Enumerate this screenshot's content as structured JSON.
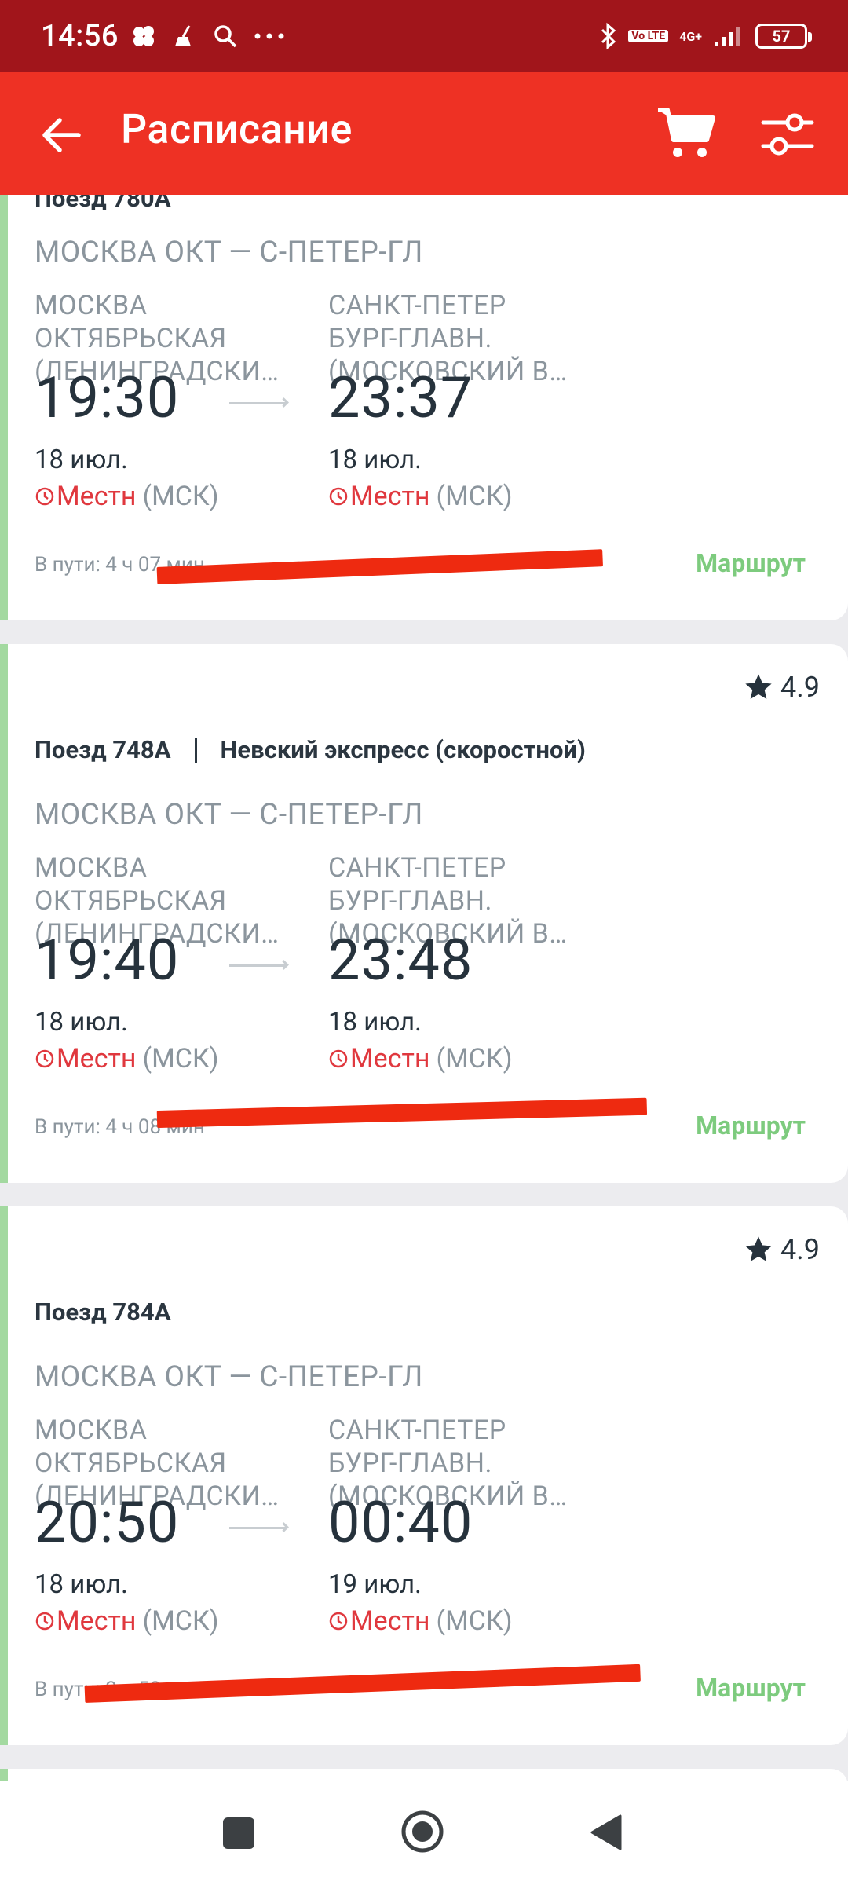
{
  "status_bar": {
    "time": "14:56",
    "network": "4G+",
    "volte": "Vo LTE",
    "battery": "57"
  },
  "app_bar": {
    "title": "Расписание"
  },
  "cards": [
    {
      "train": "Поезд 780А",
      "route": "МОСКВА ОКТ — С-ПЕТЕР-ГЛ",
      "from_station": "МОСКВА\nОКТЯБРЬСКАЯ\n(ЛЕНИНГРАДСКИ…",
      "to_station": "САНКТ-ПЕТЕР\nБУРГ-ГЛАВН.\n(МОСКОВСКИЙ В…",
      "dep_time": "19:30",
      "arr_time": "23:37",
      "dep_date": "18 июл.",
      "arr_date": "18 июл.",
      "tz_local": "Местн",
      "tz_zone": "(МСК)",
      "duration": "В пути: 4 ч 07 мин",
      "route_link": "Маршрут"
    },
    {
      "rating": "4.9",
      "train": "Поезд 748А",
      "train_name": "Невский экспресс (скоростной)",
      "route": "МОСКВА ОКТ — С-ПЕТЕР-ГЛ",
      "from_station": "МОСКВА\nОКТЯБРЬСКАЯ\n(ЛЕНИНГРАДСКИ…",
      "to_station": "САНКТ-ПЕТЕР\nБУРГ-ГЛАВН.\n(МОСКОВСКИЙ В…",
      "dep_time": "19:40",
      "arr_time": "23:48",
      "dep_date": "18 июл.",
      "arr_date": "18 июл.",
      "tz_local": "Местн",
      "tz_zone": "(МСК)",
      "duration": "В пути: 4 ч 08 мин",
      "route_link": "Маршрут"
    },
    {
      "rating": "4.9",
      "train": "Поезд 784А",
      "route": "МОСКВА ОКТ — С-ПЕТЕР-ГЛ",
      "from_station": "МОСКВА\nОКТЯБРЬСКАЯ\n(ЛЕНИНГРАДСКИ…",
      "to_station": "САНКТ-ПЕТЕР\nБУРГ-ГЛАВН.\n(МОСКОВСКИЙ В…",
      "dep_time": "20:50",
      "arr_time": "00:40",
      "dep_date": "18 июл.",
      "arr_date": "19 июл.",
      "tz_local": "Местн",
      "tz_zone": "(МСК)",
      "duration": "В пути: 3 ч 50 мин",
      "route_link": "Маршрут"
    }
  ],
  "colors": {
    "status_bar": "#a1151b",
    "app_bar": "#ee3124",
    "card_accent": "#a3d9a0",
    "route_link": "#7dcb7e",
    "local_time": "#e0383e",
    "annotation_line": "#ee2a10"
  },
  "icons": {
    "back": "arrow-left-icon",
    "cart": "cart-icon",
    "filter": "sliders-icon",
    "rating": "star-icon",
    "clock": "clock-icon"
  }
}
